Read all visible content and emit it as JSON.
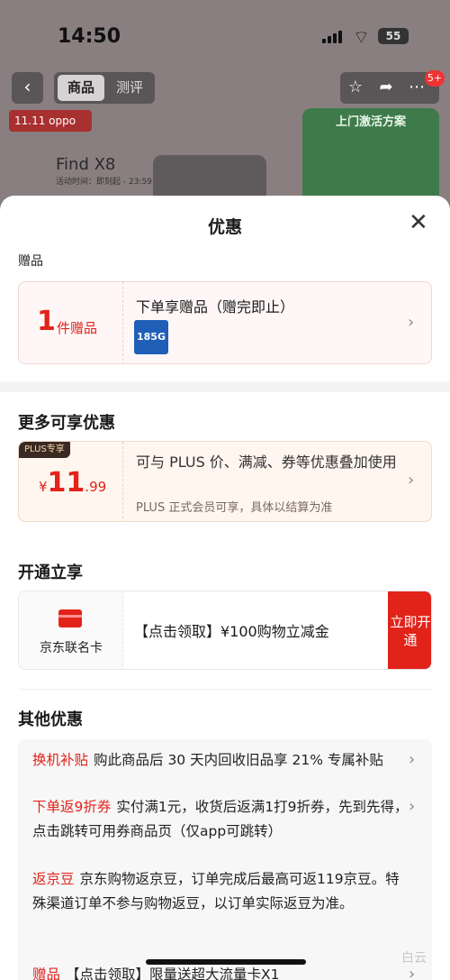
{
  "status_bar": {
    "time": "14:50",
    "battery": "55"
  },
  "background_page": {
    "tabs": [
      "商品",
      "测评"
    ],
    "badge": "5+",
    "promo_label": "11.11 oppo",
    "product_title": "Find X8",
    "product_subtitle": "活动时间：即刻起 - 23:59",
    "side_banner": "上门激活方案"
  },
  "sheet": {
    "title": "优惠",
    "gift_section_label": "赠品",
    "gift": {
      "count": "1",
      "unit": "件赠品",
      "title": "下单享赠品（赠完即止）",
      "item_label": "185G"
    },
    "more_section_title": "更多可享优惠",
    "plus": {
      "tag": "PLUS专享",
      "currency": "¥",
      "price_int": "11",
      "price_dec": ".99",
      "text": "可与 PLUS 价、满减、券等优惠叠加使用",
      "note": "PLUS 正式会员可享，具体以结算为准"
    },
    "open_section_title": "开通立享",
    "jd_card": {
      "name": "京东联名卡",
      "text": "【点击领取】¥100购物立减金",
      "button": "立即开通"
    },
    "other_section_title": "其他优惠",
    "other_rows": [
      {
        "tag": "换机补贴",
        "text": "购此商品后 30 天内回收旧品享 21% 专属补贴"
      },
      {
        "tag": "下单返9折券",
        "text": "实付满1元，收货后返满1打9折券，先到先得，点击跳转可用券商品页（仅app可跳转）"
      },
      {
        "tag": "返京豆",
        "text": "京东购物返京豆，订单完成后最高可返119京豆。特殊渠道订单不参与购物返豆，以订单实际返豆为准。"
      },
      {
        "tag": "赠品",
        "text": "【点击领取】限量送超大流量卡X1"
      }
    ]
  },
  "watermark": "白云"
}
